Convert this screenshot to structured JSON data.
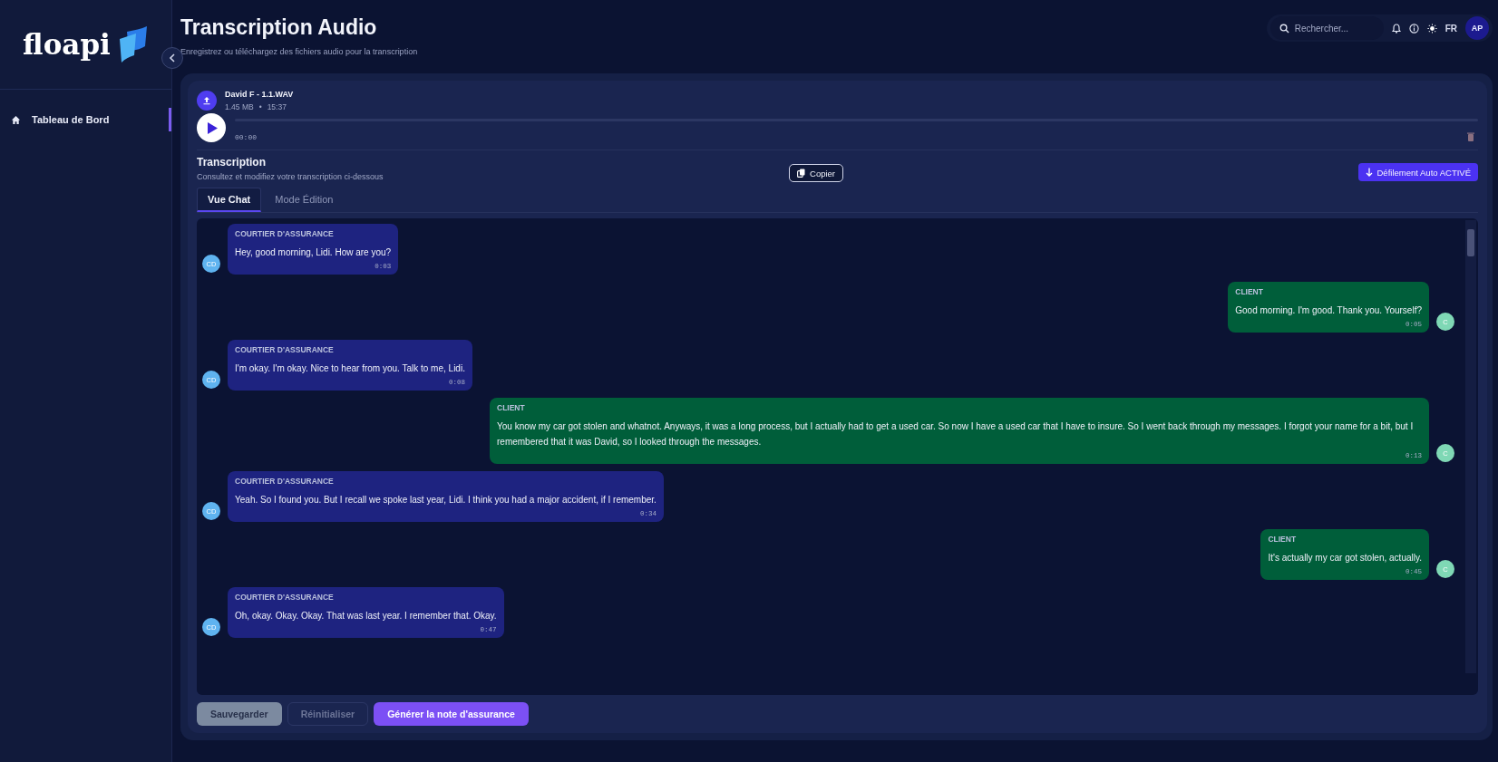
{
  "sidebar": {
    "logo": "floapi",
    "items": [
      {
        "label": "Tableau de Bord",
        "selected": true
      }
    ]
  },
  "header": {
    "title": "Transcription Audio",
    "subtitle": "Enregistrez ou téléchargez des fichiers audio pour la transcription",
    "search": {
      "placeholder": "Rechercher..."
    },
    "language": "FR",
    "avatar": "AP"
  },
  "player": {
    "file_name": "David F - 1.1.WAV",
    "size": "1.45 MB",
    "separator": "•",
    "duration": "15:37",
    "time": "00:00",
    "level": 0
  },
  "transcription": {
    "title": "Transcription",
    "subtitle": "Consultez et modifiez votre transcription ci-dessous",
    "copy_button": "Copier",
    "autoscroll_button": "Défilement Auto ACTIVÉ",
    "tabs": [
      {
        "label": "Vue Chat",
        "selected": true
      },
      {
        "label": "Mode Édition",
        "selected": false
      }
    ],
    "messages": [
      {
        "kind": "broker",
        "speaker": "COURTIER D'ASSURANCE",
        "avatar": "CD",
        "text": "Hey, good morning, Lidi. How are you?",
        "time": "0:03"
      },
      {
        "kind": "client",
        "speaker": "CLIENT",
        "avatar": "C",
        "text": "Good morning. I'm good. Thank you. Yourself?",
        "time": "0:05"
      },
      {
        "kind": "broker",
        "speaker": "COURTIER D'ASSURANCE",
        "avatar": "CD",
        "text": "I'm okay. I'm okay. Nice to hear from you. Talk to me, Lidi.",
        "time": "0:08"
      },
      {
        "kind": "client",
        "speaker": "CLIENT",
        "avatar": "C",
        "text": "You know my car got stolen and whatnot. Anyways, it was a long process, but I actually had to get a used car. So now I have a used car that I have to insure. So I went back through my messages. I forgot your name for a bit, but I remembered that it was David, so I looked through the messages.",
        "time": "0:13"
      },
      {
        "kind": "broker",
        "speaker": "COURTIER D'ASSURANCE",
        "avatar": "CD",
        "text": "Yeah. So I found you. But I recall we spoke last year, Lidi. I think you had a major accident, if I remember.",
        "time": "0:34"
      },
      {
        "kind": "client",
        "speaker": "CLIENT",
        "avatar": "C",
        "text": "It's actually my car got stolen, actually.",
        "time": "0:45"
      },
      {
        "kind": "broker",
        "speaker": "COURTIER D'ASSURANCE",
        "avatar": "CD",
        "text": "Oh, okay. Okay. Okay. That was last year. I remember that. Okay.",
        "time": "0:47"
      }
    ],
    "actions": [
      {
        "kind": "secondary",
        "label": "Sauvegarder"
      },
      {
        "kind": "disabled",
        "label": "Réinitialiser"
      },
      {
        "kind": "primary",
        "label": "Générer la note d'assurance"
      }
    ]
  }
}
